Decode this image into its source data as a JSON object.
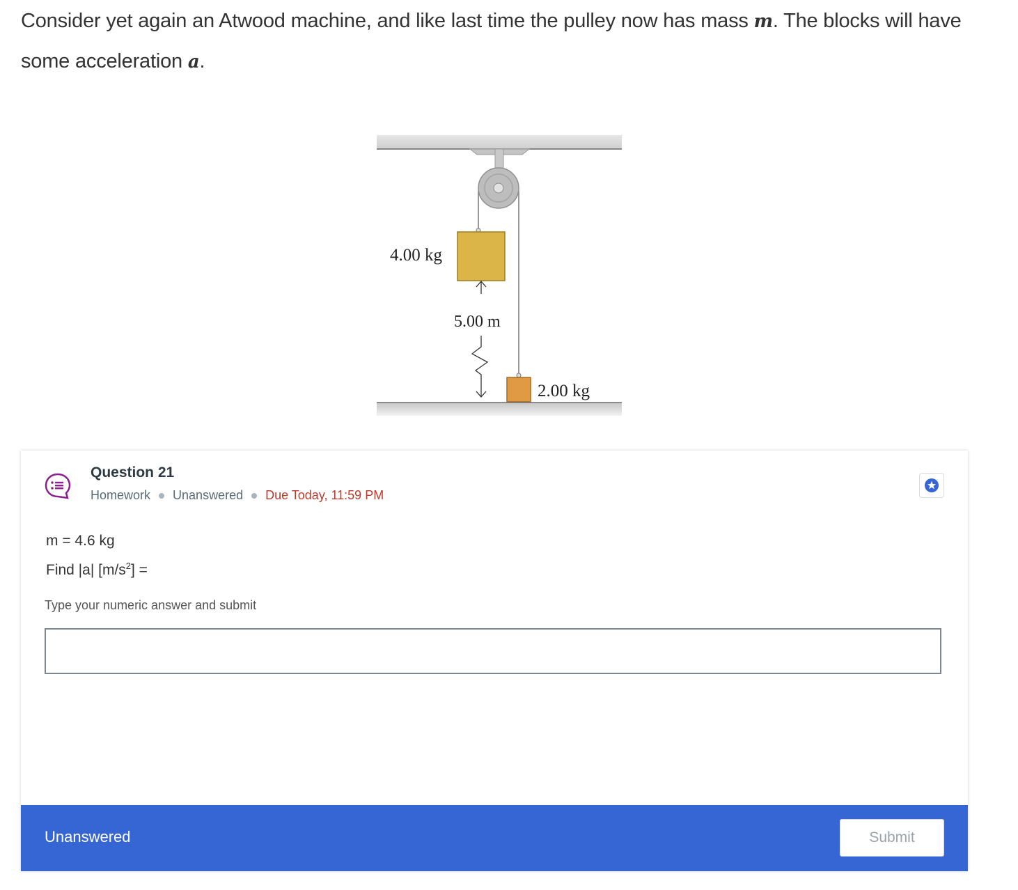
{
  "intro": {
    "line1_before": "Consider yet again an Atwood machine, and like last time the pulley now has mass ",
    "var_m": "m",
    "line1_after": ". The blocks will have",
    "line2_before": "some acceleration ",
    "var_a": "a",
    "line2_after": "."
  },
  "figure": {
    "mass_upper": "4.00 kg",
    "distance": "5.00 m",
    "mass_lower": "2.00 kg",
    "colors": {
      "upper_block": "#dbb548",
      "lower_block": "#e09a44",
      "pulley": "#b9b9b9"
    }
  },
  "question": {
    "title": "Question 21",
    "type": "Homework",
    "status": "Unanswered",
    "due": "Due Today, 11:59 PM",
    "icon": "question-bubble-icon",
    "star_icon": "star-icon",
    "given": "m = 4.6 kg",
    "find_before": "Find |a| [m/s",
    "find_sup": "2",
    "find_after": "] =",
    "instruction": "Type your numeric answer and submit",
    "answer_value": "",
    "footer_status": "Unanswered",
    "submit_label": "Submit",
    "colors": {
      "footer": "#3666d3",
      "due": "#c0392b",
      "icon": "#8b1f8f"
    }
  }
}
